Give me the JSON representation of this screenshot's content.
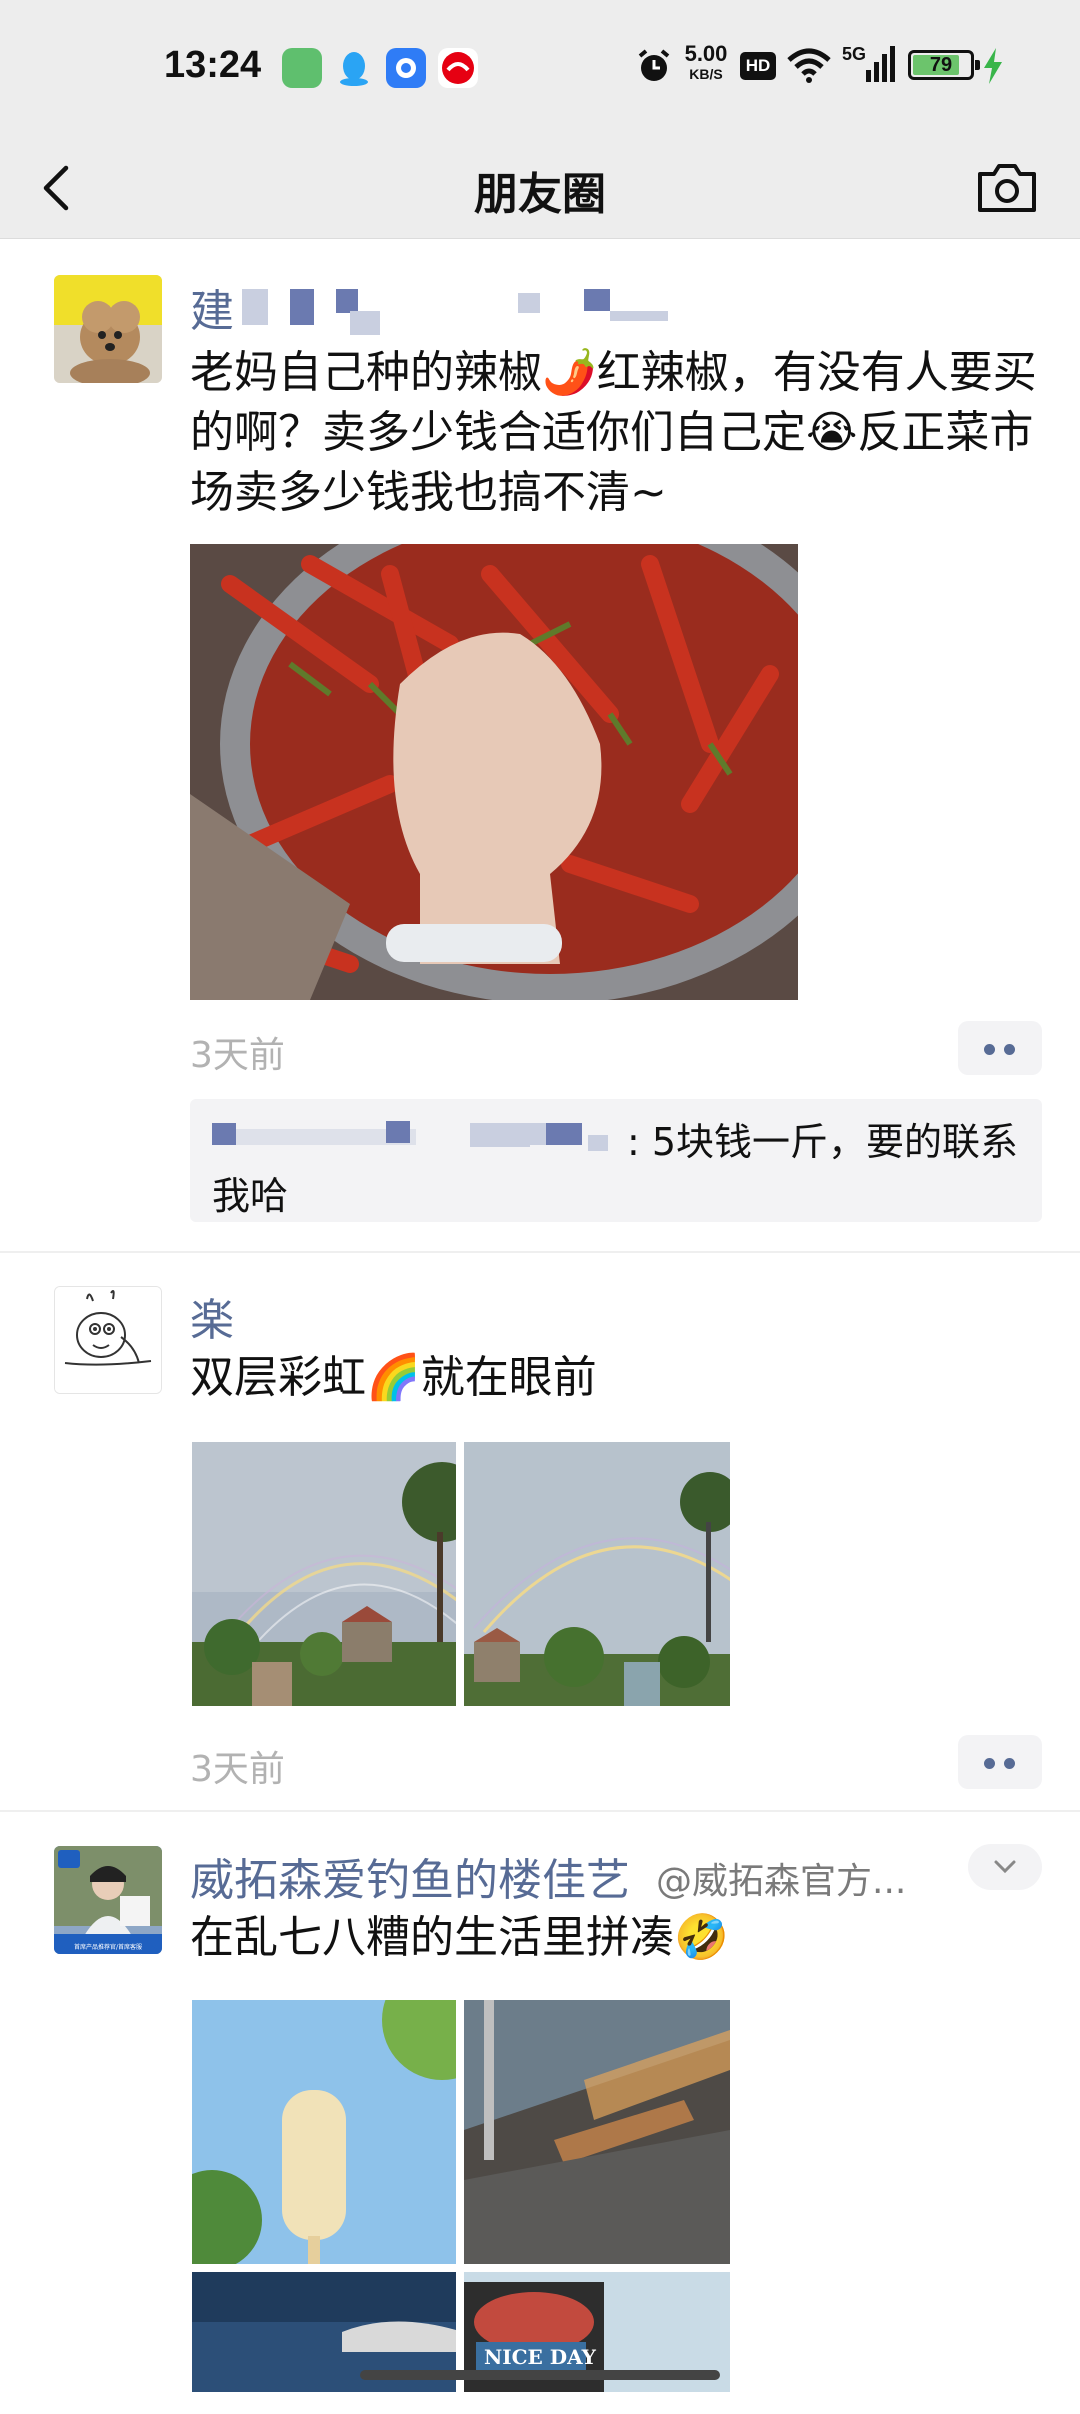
{
  "status_bar": {
    "time": "13:24",
    "net_speed_value": "5.00",
    "net_speed_unit": "KB/S",
    "hd_label": "HD",
    "signal_label": "5G",
    "battery": "79"
  },
  "titlebar": {
    "title": "朋友圈"
  },
  "posts": [
    {
      "name": "建",
      "text": "老妈自己种的辣椒🌶️红辣椒，有没有人要买的啊？卖多少钱合适你们自己定😭反正菜市场卖多少钱我也搞不清~",
      "time_ago": "3天前",
      "comment": ": 5块钱一斤，要的联系我哈"
    },
    {
      "name": "楽",
      "text": "双层彩虹🌈就在眼前",
      "time_ago": "3天前"
    },
    {
      "name": "威拓森爱钓鱼的楼佳艺",
      "handle": "@威拓森官方...",
      "text": "在乱七八糟的生活里拼凑🤣",
      "avatar_caption": "首席产品推荐官/首席客服"
    }
  ],
  "colors": {
    "name_blue": "#576b95",
    "bar_bg": "#ededed",
    "time_gray": "#b2b2b2",
    "comment_bg": "#f3f3f5"
  },
  "icons": [
    "back-arrow-icon",
    "camera-icon",
    "more-dots-icon",
    "collapse-chevron-icon"
  ]
}
